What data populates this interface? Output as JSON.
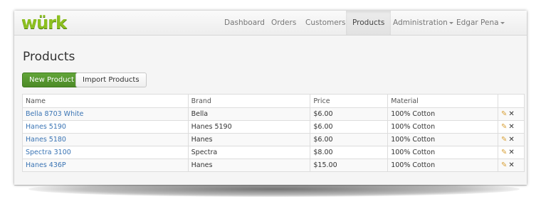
{
  "app": {
    "logo": "würk"
  },
  "nav": {
    "items": [
      {
        "label": "Dashboard"
      },
      {
        "label": "Orders"
      },
      {
        "label": "Customers"
      },
      {
        "label": "Products"
      },
      {
        "label": "Administration"
      },
      {
        "label": "Edgar Pena"
      }
    ],
    "active": "Products"
  },
  "page": {
    "title": "Products",
    "new_button": "New Product",
    "import_button": "Import Products"
  },
  "table": {
    "headers": [
      "Name",
      "Brand",
      "Price",
      "Material",
      ""
    ],
    "rows": [
      {
        "name": "Bella 8703 White",
        "brand": "Bella",
        "price": "$6.00",
        "material": "100% Cotton"
      },
      {
        "name": "Hanes 5190",
        "brand": "Hanes 5190",
        "price": "$6.00",
        "material": "100% Cotton"
      },
      {
        "name": "Hanes 5180",
        "brand": "Hanes",
        "price": "$6.00",
        "material": "100% Cotton"
      },
      {
        "name": "Spectra 3100",
        "brand": "Spectra",
        "price": "$8.00",
        "material": "100% Cotton"
      },
      {
        "name": "Hanes 436P",
        "brand": "Hanes",
        "price": "$15.00",
        "material": "100% Cotton"
      }
    ]
  },
  "icons": {
    "edit": "pencil-icon",
    "delete": "close-icon"
  },
  "colors": {
    "brand": "#8cbf1f",
    "primary_button": "#54932d",
    "link": "#3a74b4"
  }
}
